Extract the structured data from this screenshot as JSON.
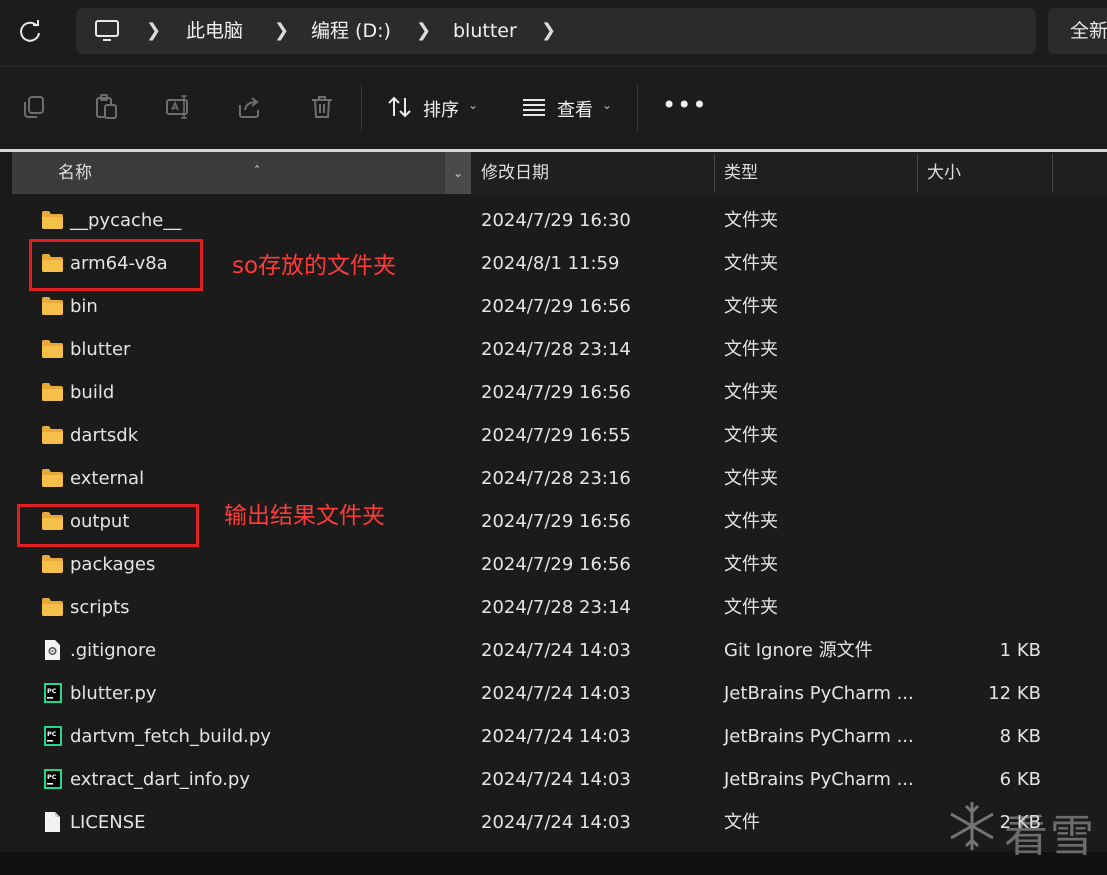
{
  "address_bar": {
    "breadcrumbs": [
      "此电脑",
      "编程 (D:)",
      "blutter"
    ],
    "right_button": "全新"
  },
  "toolbar": {
    "sort_label": "排序",
    "view_label": "查看"
  },
  "columns": {
    "name": "名称",
    "date": "修改日期",
    "type": "类型",
    "size": "大小"
  },
  "files": [
    {
      "name": "__pycache__",
      "date": "2024/7/29 16:30",
      "type": "文件夹",
      "size": "",
      "icon": "folder-icon"
    },
    {
      "name": "arm64-v8a",
      "date": "2024/8/1 11:59",
      "type": "文件夹",
      "size": "",
      "icon": "folder-icon"
    },
    {
      "name": "bin",
      "date": "2024/7/29 16:56",
      "type": "文件夹",
      "size": "",
      "icon": "folder-icon"
    },
    {
      "name": "blutter",
      "date": "2024/7/28 23:14",
      "type": "文件夹",
      "size": "",
      "icon": "folder-icon"
    },
    {
      "name": "build",
      "date": "2024/7/29 16:56",
      "type": "文件夹",
      "size": "",
      "icon": "folder-icon"
    },
    {
      "name": "dartsdk",
      "date": "2024/7/29 16:55",
      "type": "文件夹",
      "size": "",
      "icon": "folder-icon"
    },
    {
      "name": "external",
      "date": "2024/7/28 23:16",
      "type": "文件夹",
      "size": "",
      "icon": "folder-icon"
    },
    {
      "name": "output",
      "date": "2024/7/29 16:56",
      "type": "文件夹",
      "size": "",
      "icon": "folder-icon"
    },
    {
      "name": "packages",
      "date": "2024/7/29 16:56",
      "type": "文件夹",
      "size": "",
      "icon": "folder-icon"
    },
    {
      "name": "scripts",
      "date": "2024/7/28 23:14",
      "type": "文件夹",
      "size": "",
      "icon": "folder-icon"
    },
    {
      "name": ".gitignore",
      "date": "2024/7/24 14:03",
      "type": "Git Ignore 源文件",
      "size": "1 KB",
      "icon": "gitignore-file-icon"
    },
    {
      "name": "blutter.py",
      "date": "2024/7/24 14:03",
      "type": "JetBrains PyCharm ...",
      "size": "12 KB",
      "icon": "pycharm-file-icon"
    },
    {
      "name": "dartvm_fetch_build.py",
      "date": "2024/7/24 14:03",
      "type": "JetBrains PyCharm ...",
      "size": "8 KB",
      "icon": "pycharm-file-icon"
    },
    {
      "name": "extract_dart_info.py",
      "date": "2024/7/24 14:03",
      "type": "JetBrains PyCharm ...",
      "size": "6 KB",
      "icon": "pycharm-file-icon"
    },
    {
      "name": "LICENSE",
      "date": "2024/7/24 14:03",
      "type": "文件",
      "size": "2 KB",
      "icon": "blank-file-icon"
    }
  ],
  "annotations": {
    "so_folder": "so存放的文件夹",
    "output_folder": "输出结果文件夹"
  },
  "watermark": "看雪",
  "colors": {
    "annotation_red": "#e02020",
    "folder_yellow": "#f5c04a",
    "background": "#191919"
  }
}
